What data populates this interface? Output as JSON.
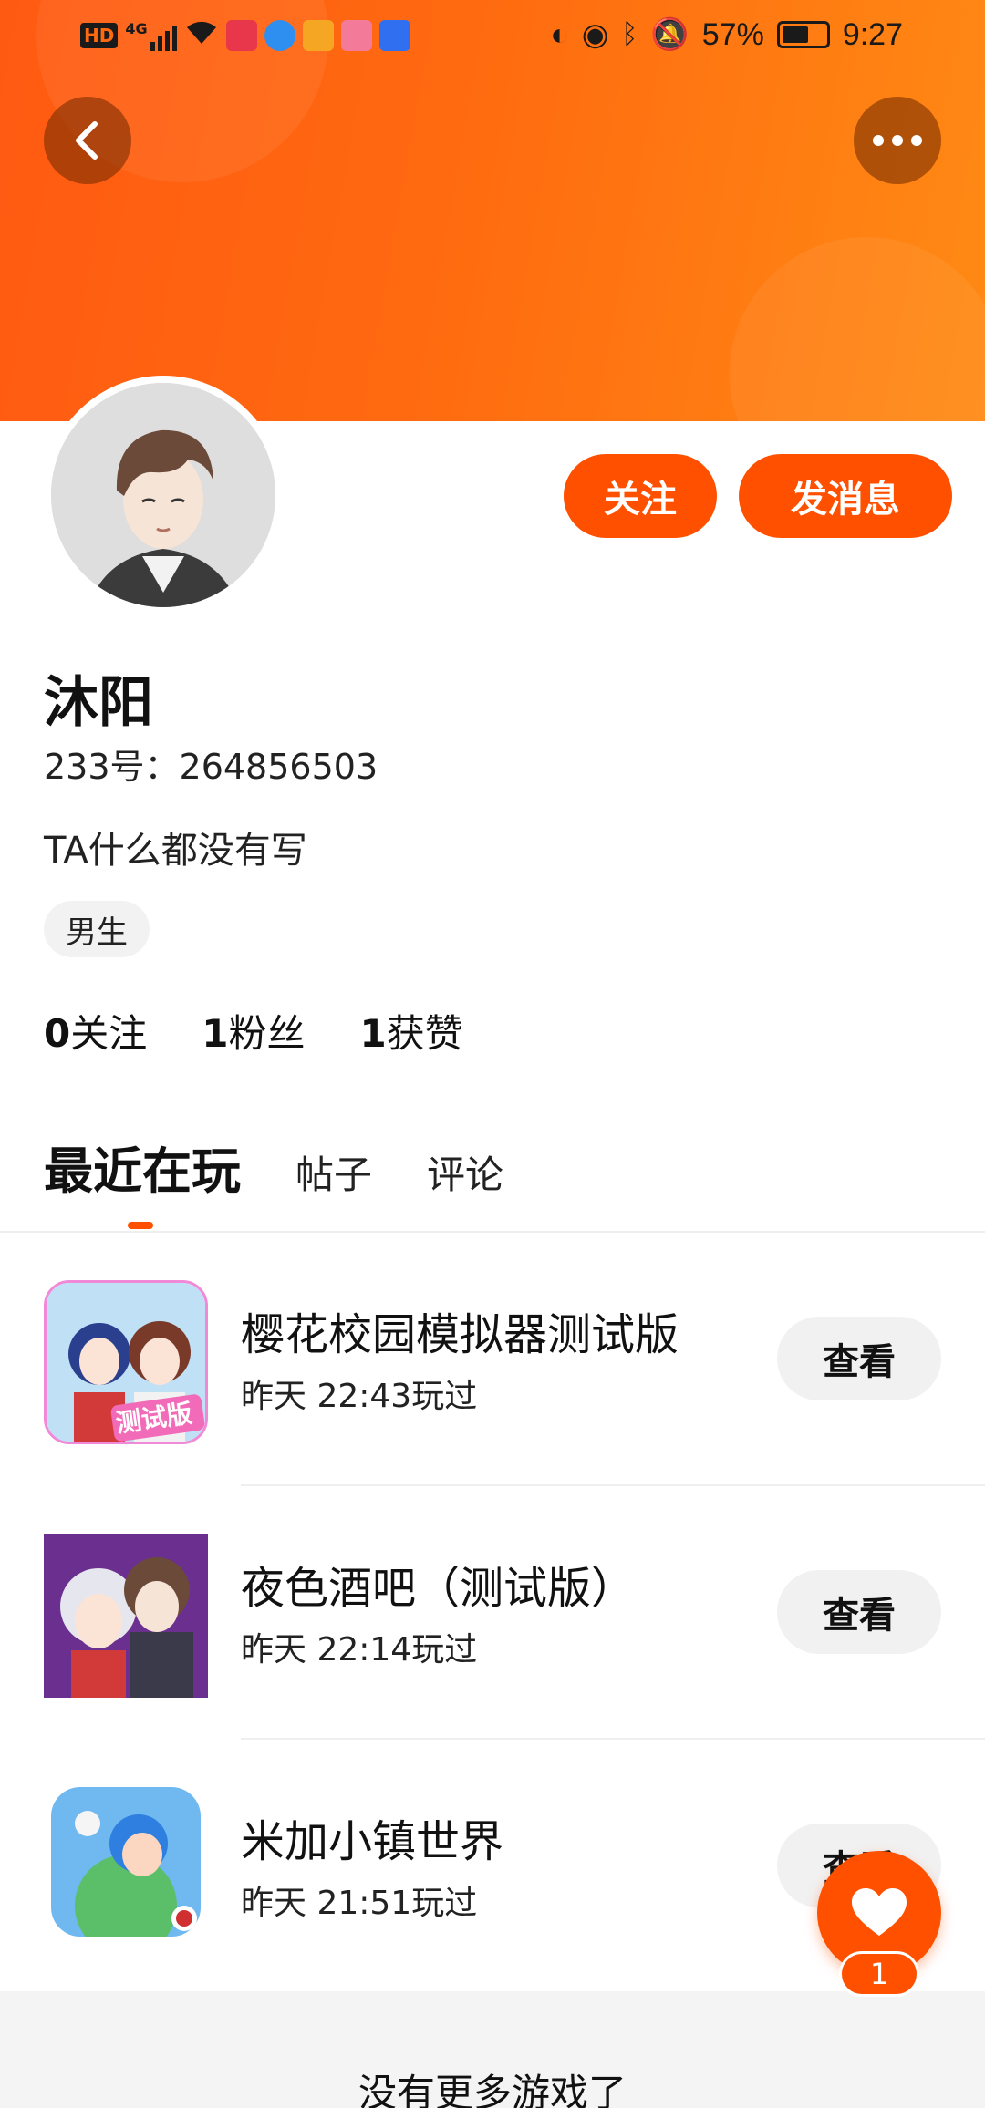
{
  "status_bar": {
    "net_type": "HD",
    "signal_label": "4G",
    "battery": "57%",
    "battery_level": 0.57,
    "time": "9:27"
  },
  "header": {
    "back_icon": "chevron-left-icon",
    "more_icon": "more-dots-icon"
  },
  "profile": {
    "name": "沐阳",
    "uid_line": "233号：264856503",
    "bio": "TA什么都没有写",
    "gender_tag": "男生",
    "follow_label": "关注",
    "message_label": "发消息"
  },
  "stats": [
    {
      "count": "0",
      "label": "关注"
    },
    {
      "count": "1",
      "label": "粉丝"
    },
    {
      "count": "1",
      "label": "获赞"
    }
  ],
  "tabs": [
    {
      "label": "最近在玩",
      "active": true
    },
    {
      "label": "帖子",
      "active": false
    },
    {
      "label": "评论",
      "active": false
    }
  ],
  "games": [
    {
      "title": "樱花校园模拟器测试版",
      "time": "昨天 22:43玩过",
      "button": "查看",
      "icon_badge": "测试版"
    },
    {
      "title": "夜色酒吧（测试版）",
      "time": "昨天 22:14玩过",
      "button": "查看"
    },
    {
      "title": "米加小镇世界",
      "time": "昨天 21:51玩过",
      "button": "查看"
    }
  ],
  "footer": {
    "text": "没有更多游戏了"
  },
  "fab": {
    "icon": "heart-icon",
    "badge": "1"
  },
  "colors": {
    "accent": "#ff5000",
    "header_gradient_start": "#ff5a12",
    "header_gradient_end": "#ff8a14"
  }
}
